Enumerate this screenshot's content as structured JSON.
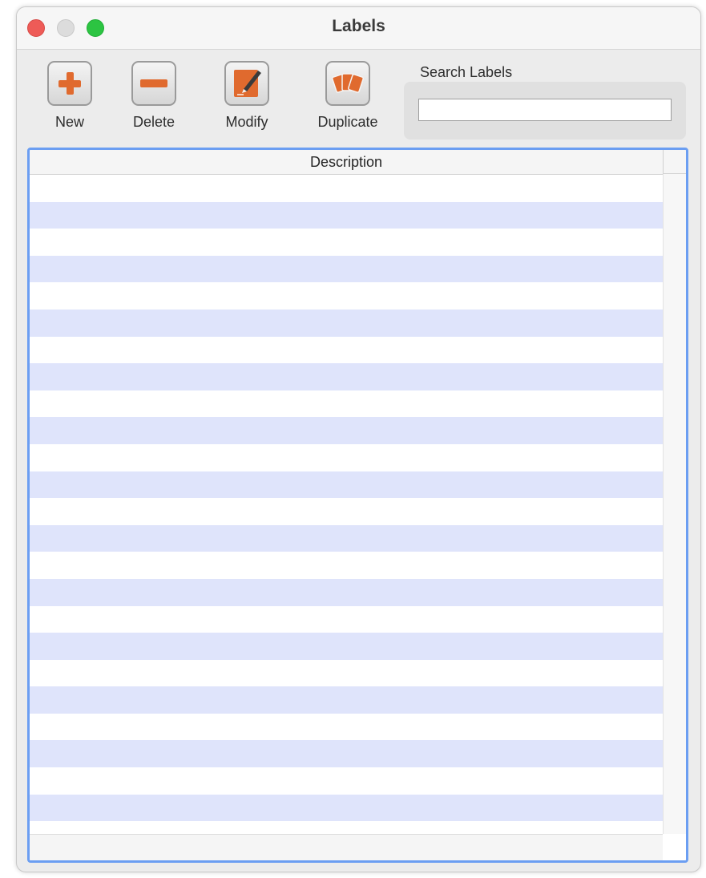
{
  "window": {
    "title": "Labels"
  },
  "toolbar": {
    "new_label": "New",
    "delete_label": "Delete",
    "modify_label": "Modify",
    "duplicate_label": "Duplicate"
  },
  "search": {
    "label": "Search Labels",
    "value": "",
    "placeholder": ""
  },
  "table": {
    "columns": [
      "Description"
    ],
    "rows": []
  },
  "icons": {
    "new": "plus-icon",
    "delete": "minus-icon",
    "modify": "edit-pencil-icon",
    "duplicate": "duplicate-cards-icon"
  },
  "colors": {
    "accent_orange": "#e06a2e",
    "selection_border": "#6b9ef2",
    "row_stripe": "#dfe4fb",
    "close": "#ee5b57",
    "minimize": "#dcdcdc",
    "maximize": "#2cc442"
  }
}
